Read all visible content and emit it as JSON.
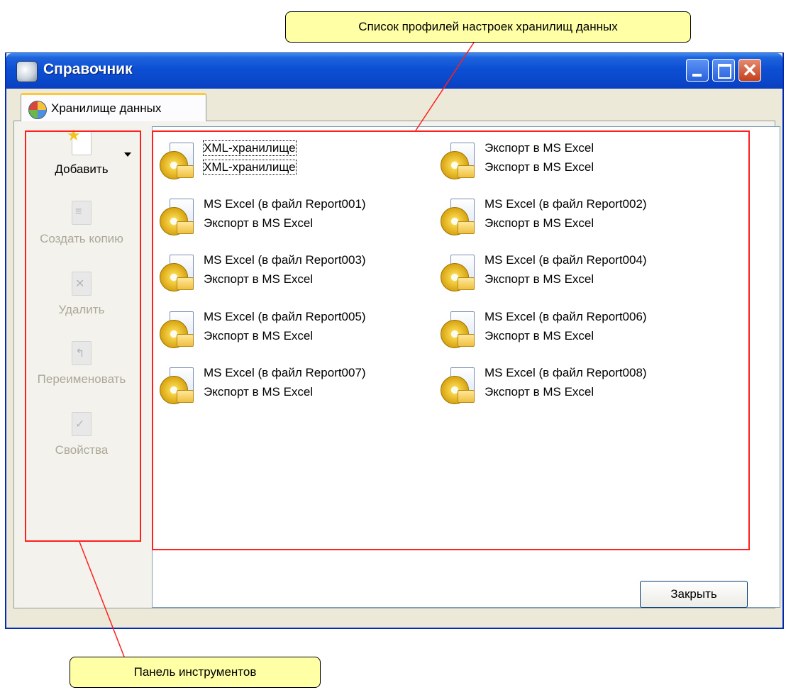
{
  "window": {
    "title": "Справочник"
  },
  "tab": {
    "label": "Хранилище данных"
  },
  "toolbar": {
    "items": [
      {
        "label": "Добавить",
        "enabled": true,
        "icon": "new-document-star-icon"
      },
      {
        "label": "Создать копию",
        "enabled": false,
        "icon": "copy-document-icon"
      },
      {
        "label": "Удалить",
        "enabled": false,
        "icon": "delete-document-icon"
      },
      {
        "label": "Переименовать",
        "enabled": false,
        "icon": "rename-document-icon"
      },
      {
        "label": "Свойства",
        "enabled": false,
        "icon": "properties-document-icon"
      }
    ]
  },
  "profiles": [
    {
      "name": "XML-хранилище",
      "description": "XML-хранилище"
    },
    {
      "name": "Экспорт в MS Excel",
      "description": "Экспорт в MS Excel"
    },
    {
      "name": "MS Excel (в файл Report001)",
      "description": "Экспорт в MS Excel"
    },
    {
      "name": "MS Excel (в файл Report002)",
      "description": "Экспорт в MS Excel"
    },
    {
      "name": "MS Excel (в файл Report003)",
      "description": "Экспорт в MS Excel"
    },
    {
      "name": "MS Excel (в файл Report004)",
      "description": "Экспорт в MS Excel"
    },
    {
      "name": "MS Excel (в файл Report005)",
      "description": "Экспорт в MS Excel"
    },
    {
      "name": "MS Excel (в файл Report006)",
      "description": "Экспорт в MS Excel"
    },
    {
      "name": "MS Excel (в файл Report007)",
      "description": "Экспорт в MS Excel"
    },
    {
      "name": "MS Excel (в файл Report008)",
      "description": "Экспорт в MS Excel"
    }
  ],
  "buttons": {
    "close": "Закрыть"
  },
  "callouts": {
    "profiles": "Список профилей настроек хранилищ данных",
    "toolbar": "Панель инструментов"
  },
  "colors": {
    "titlebar": "#0a47c8",
    "callout": "#ffffa6",
    "highlight": "#ff1f1f"
  }
}
